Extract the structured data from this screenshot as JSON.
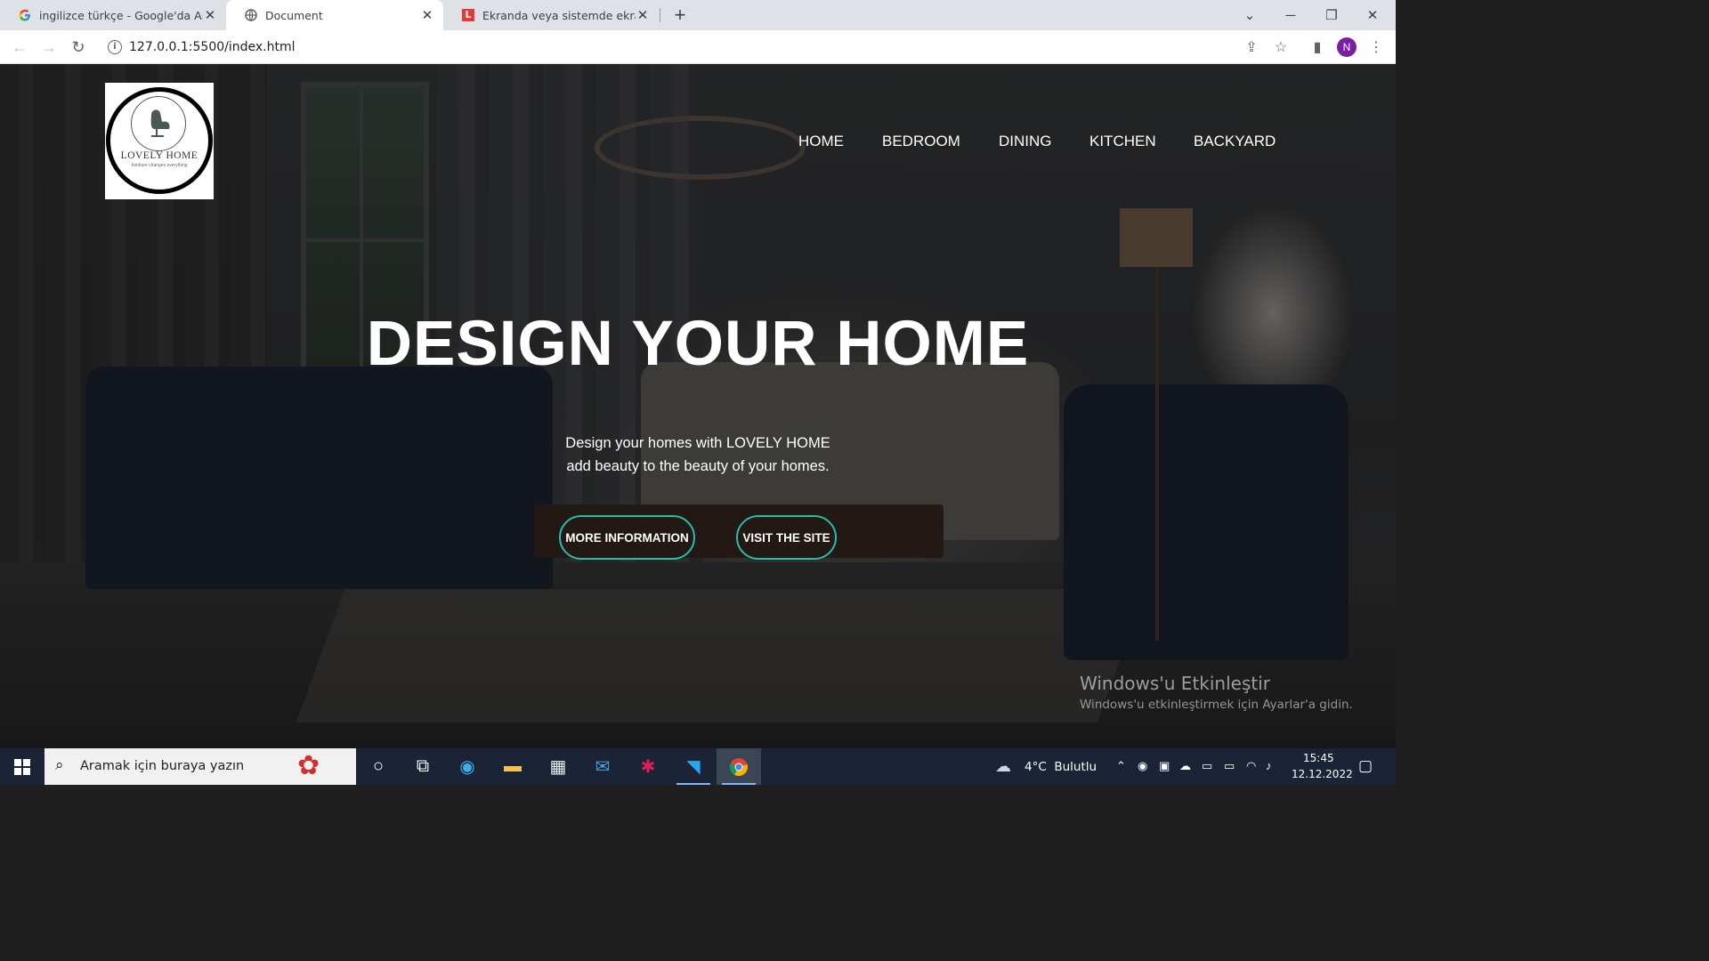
{
  "browser": {
    "tabs": [
      {
        "title": "ingilizce türkçe - Google'da Ara",
        "favicon": "google-icon",
        "active": false
      },
      {
        "title": "Document",
        "favicon": "globe-icon",
        "active": true
      },
      {
        "title": "Ekranda veya sistemde ekran gör",
        "favicon": "l-red-icon",
        "active": false
      }
    ],
    "new_tab": "+",
    "url": "127.0.0.1:5500/index.html",
    "profile_initial": "N"
  },
  "site": {
    "logo": {
      "name": "LOVELY HOME",
      "tagline": "furniture changes everything"
    },
    "nav": [
      "HOME",
      "BEDROOM",
      "DINING",
      "KITCHEN",
      "BACKYARD"
    ],
    "hero": {
      "title": "DESIGN YOUR HOME",
      "subtitle_line1": "Design your homes with LOVELY HOME",
      "subtitle_line2": "add beauty to the beauty of your homes."
    },
    "buttons": {
      "more_info": "MORE INFORMATION",
      "visit": "VISIT THE SITE"
    },
    "accent_color": "#2bbbad"
  },
  "watermark": {
    "title": "Windows'u Etkinleştir",
    "subtitle": "Windows'u etkinleştirmek için Ayarlar'a gidin."
  },
  "taskbar": {
    "search_placeholder": "Aramak için buraya yazın",
    "weather": "4°C  Bulutlu",
    "time": "15:45",
    "date": "12.12.2022"
  }
}
